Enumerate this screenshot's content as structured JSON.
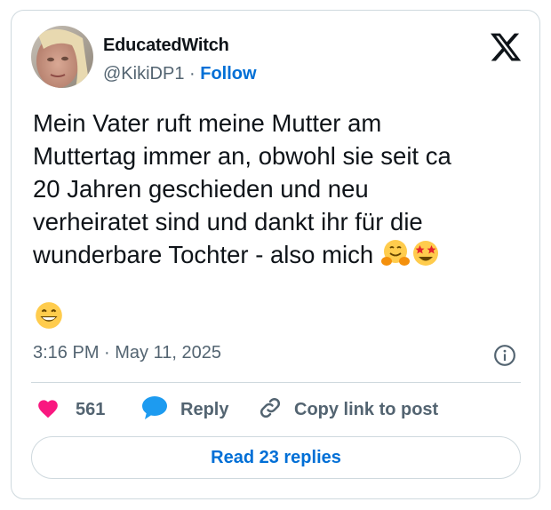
{
  "author": {
    "display_name": "EducatedWitch",
    "handle": "@KikiDP1",
    "separator": "·",
    "follow_label": "Follow"
  },
  "icons": {
    "brand": "x-logo-icon",
    "info": "info-icon",
    "like": "heart-icon",
    "reply": "speech-bubble-icon",
    "copy": "link-icon",
    "emoji": [
      "smiling-face-with-open-hands-emoji",
      "star-struck-emoji",
      "grinning-face-with-smiling-eyes-emoji"
    ]
  },
  "tweet": {
    "text": "Mein Vater ruft meine Mutter am\nMuttertag immer an, obwohl sie seit ca\n20 Jahren geschieden und neu\nverheiratet sind und dankt ihr für die\nwunderbare Tochter - also mich ",
    "timestamp": "3:16 PM · May 11, 2025"
  },
  "actions": {
    "like_count": "561",
    "reply_label": "Reply",
    "copy_label": "Copy link to post"
  },
  "read_replies_label": "Read 23 replies",
  "colors": {
    "accent": "#006fd6",
    "heart": "#f91880",
    "reply_bubble": "#1d9bf0",
    "muted_text": "#536471",
    "border": "#cfd9de"
  }
}
